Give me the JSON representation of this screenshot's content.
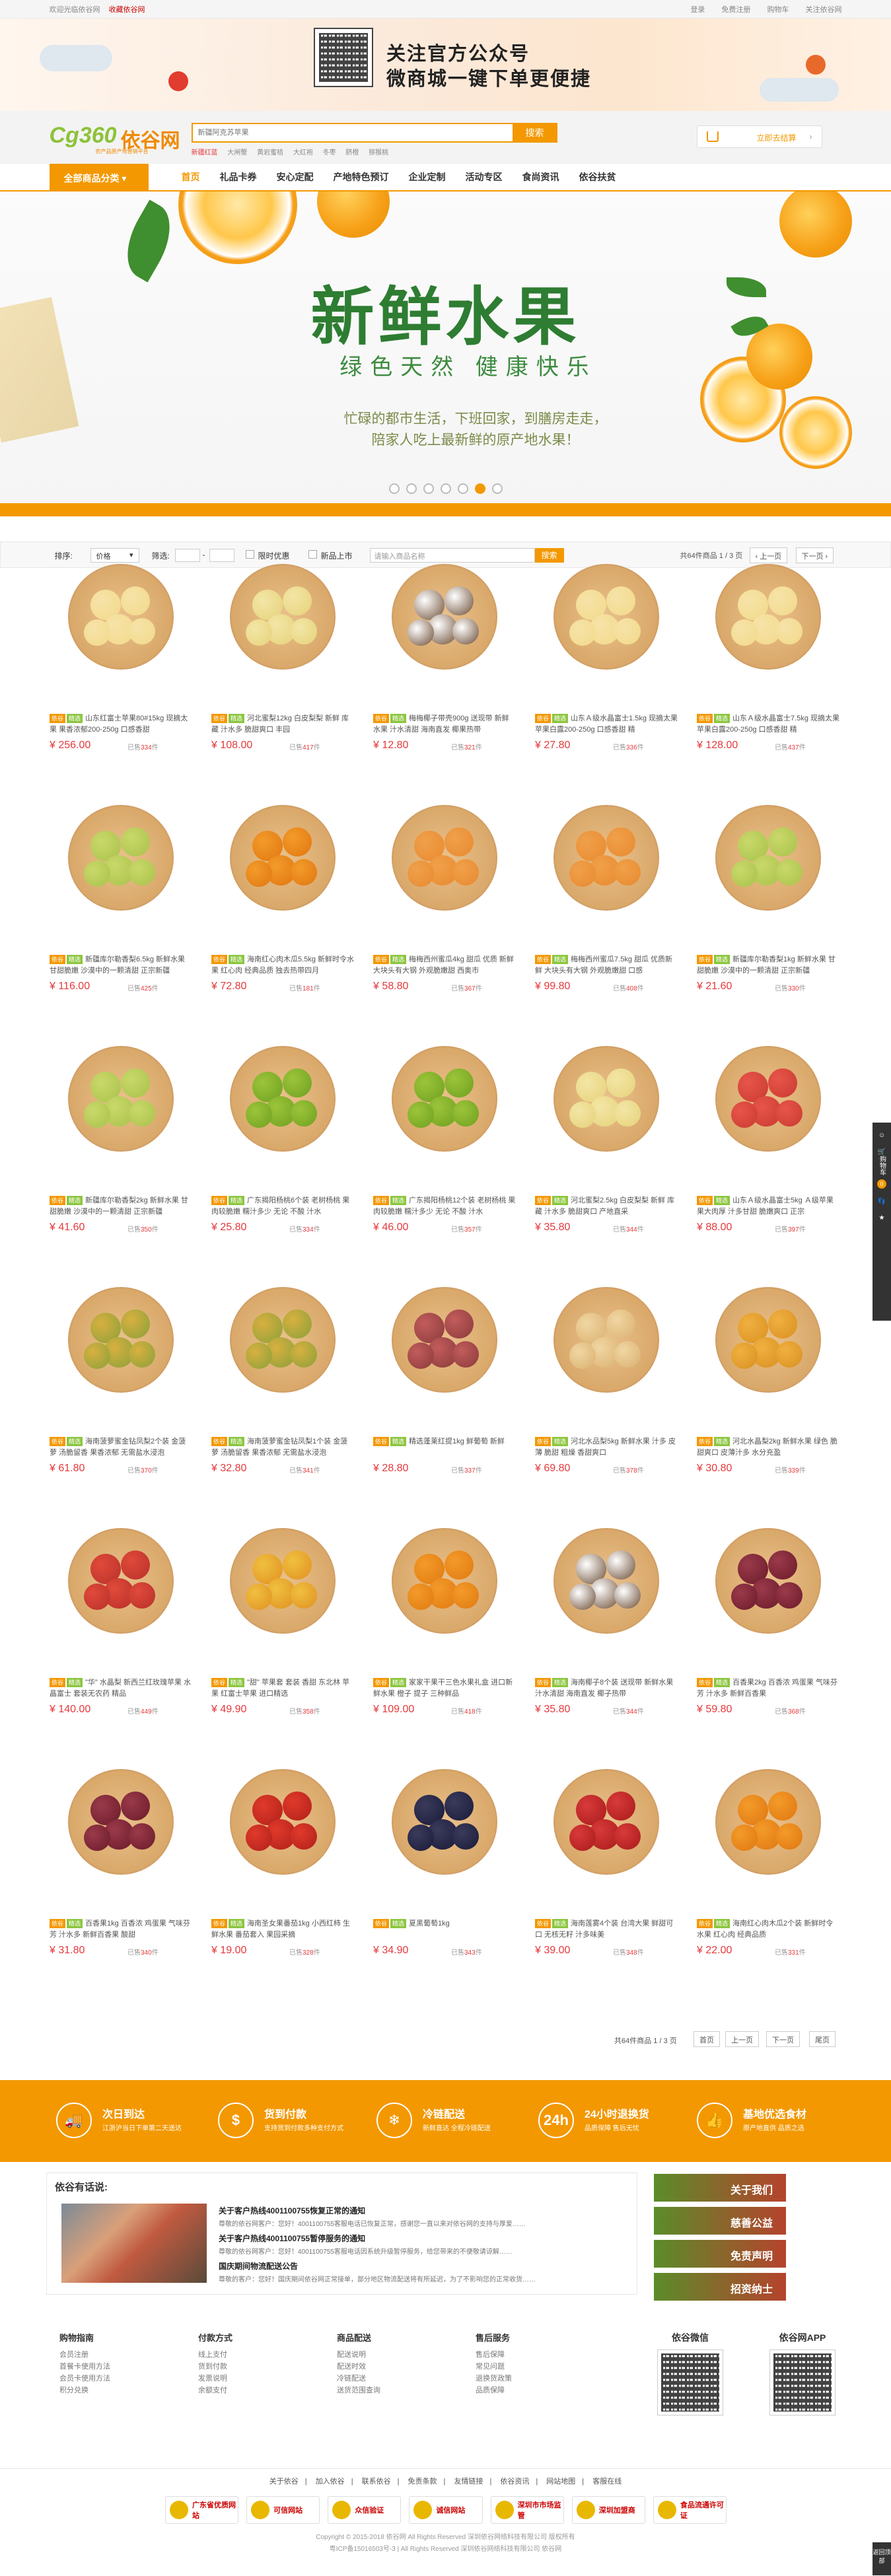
{
  "topbar": {
    "welcome": "欢迎光临依谷网",
    "favorite": "收藏依谷网",
    "login": "登录",
    "register": "免费注册",
    "cart": "购物车",
    "about": "关注依谷网"
  },
  "promo": {
    "line1": "关注官方公众号",
    "line2": "微商城一键下单更便捷"
  },
  "header": {
    "logo_mark": "Cg360",
    "logo_text": "依谷网",
    "logo_tagline": "农产品原产地营销平台",
    "search_placeholder": "新疆阿克苏苹果",
    "search_button": "搜索",
    "hot_words": [
      "新疆红蓝",
      "大闸蟹",
      "黄岩蜜桔",
      "大红袍",
      "冬枣",
      "脐橙",
      "猕猴桃"
    ],
    "cart_label": "立即去结算"
  },
  "nav": {
    "all_categories": "全部商品分类",
    "links": [
      "首页",
      "礼品卡券",
      "安心定配",
      "产地特色预订",
      "企业定制",
      "活动专区",
      "食尚资讯",
      "依谷扶贫"
    ]
  },
  "hero": {
    "title": "新鲜水果",
    "subtitle": "绿色天然 健康快乐",
    "desc1": "忙碌的都市生活，下班回家，到膳房走走，",
    "desc2": "陪家人吃上最新鲜的原产地水果！"
  },
  "filter": {
    "sort_label": "排序:",
    "sort_value": "价格",
    "range_label": "筛选:",
    "price_sep": "-",
    "check1": "限时优惠",
    "check2": "新品上市",
    "keyword_placeholder": "请输入商品名称",
    "search": "搜索",
    "page_info": "共64件商品 1 / 3 页",
    "prev": "上一页",
    "next": "下一页"
  },
  "products": [
    {
      "name": "山东红富士苹果80#15kg 现摘太果 果香浓郁200-250g 口感香甜",
      "price": "¥ 256.00",
      "sold": "334"
    },
    {
      "name": "河北蜜梨12kg 白皮梨梨 新鲜 库藏 汁水多 脆甜爽口 丰园",
      "price": "¥ 108.00",
      "sold": "417"
    },
    {
      "name": "梅梅椰子带壳900g 送现带 新鲜水果 汁水清甜 海南直发 椰果热带",
      "price": "¥ 12.80",
      "sold": "321"
    },
    {
      "name": "山东Ａ级水晶富士1.5kg 现摘太果 苹果白露200-250g 口感香甜 精",
      "price": "¥ 27.80",
      "sold": "336"
    },
    {
      "name": "山东Ａ级水晶富士7.5kg 现摘太果 苹果白露200-250g 口感香甜 精",
      "price": "¥ 128.00",
      "sold": "437"
    },
    {
      "name": "新疆库尔勒香梨6.5kg 新鲜水果 甘甜脆嫩 沙漠中的一颗清甜 正宗新疆",
      "price": "¥ 116.00",
      "sold": "425"
    },
    {
      "name": "海南红心肉木瓜5.5kg 新鲜时令水果 红心肉 经典品质 独去热带四月",
      "price": "¥ 72.80",
      "sold": "181"
    },
    {
      "name": "梅梅西州蜜瓜4kg 甜瓜 优质 新鲜 大块头有大钢 外观脆嫩甜 西奥市",
      "price": "¥ 58.80",
      "sold": "367"
    },
    {
      "name": "梅梅西州蜜瓜7.5kg 甜瓜 优质新鲜 大块头有大钢 外观脆嫩甜 口感",
      "price": "¥ 99.80",
      "sold": "408"
    },
    {
      "name": "新疆库尔勒香梨1kg 新鲜水果 甘甜脆嫩 沙漠中的一颗清甜 正宗新疆",
      "price": "¥ 21.60",
      "sold": "330"
    },
    {
      "name": "新疆库尔勒香梨2kg 新鲜水果 甘甜脆嫩 沙漠中的一颗清甜 正宗新疆",
      "price": "¥ 41.60",
      "sold": "350"
    },
    {
      "name": "广东揭阳杨桃6个装 老树杨桃 果肉较脆嫩 糯汁多少 无论 不酸 汁水",
      "price": "¥ 25.80",
      "sold": "334"
    },
    {
      "name": "广东揭阳杨桃12个装 老树杨桃 果肉较脆嫩 糯汁多少 无论 不酸 汁水",
      "price": "¥ 46.00",
      "sold": "357"
    },
    {
      "name": "河北蜜梨2.5kg 白皮梨梨 新鲜 库藏 汁水多 脆甜爽口 产地直采",
      "price": "¥ 35.80",
      "sold": "344"
    },
    {
      "name": "山东Ａ级水晶富士5kg Ａ级苹果 果大肉厚 汁多甘甜 脆嫩爽口 正宗",
      "price": "¥ 88.00",
      "sold": "397"
    },
    {
      "name": "海南菠萝蜜金钻凤梨2个装 金菠萝 汤脆留香 果香浓郁 无需盐水浸泡",
      "price": "¥ 61.80",
      "sold": "370"
    },
    {
      "name": "海南菠萝蜜金钻凤梨1个装 金菠萝 汤脆留香 果香浓郁 无需盐水浸泡",
      "price": "¥ 32.80",
      "sold": "341"
    },
    {
      "name": "精选蓬莱红提1kg 鲜葡萄 新鲜",
      "price": "¥ 28.80",
      "sold": "337"
    },
    {
      "name": "河北水品梨5kg 新鲜水果 汁多 皮薄 脆甜 粗燥 香甜爽口",
      "price": "¥ 69.80",
      "sold": "378"
    },
    {
      "name": "河北水晶梨2kg 新鲜水果 绿色 脆甜爽口 皮薄汁多 水分充盈",
      "price": "¥ 30.80",
      "sold": "339"
    },
    {
      "name": "\"华\" 水晶梨 新西兰红玫瑰苹果 水晶富士 套装无农药 精品",
      "price": "¥ 140.00",
      "sold": "449"
    },
    {
      "name": "\"甜\" 苹果套 套装 香甜 东北林 苹果 红富士苹果 进口精选",
      "price": "¥ 49.90",
      "sold": "358"
    },
    {
      "name": "家家干果干三色水果礼盒 进口新鲜水果 橙子 提子 三种鲜品",
      "price": "¥ 109.00",
      "sold": "418"
    },
    {
      "name": "海南椰子8个装 送现带 新鲜水果 汁水清甜 海南直发 椰子热带",
      "price": "¥ 35.80",
      "sold": "344"
    },
    {
      "name": "百香果2kg 百香浓 鸡蛋果 气味芬芳 汁水多 新鲜百香果",
      "price": "¥ 59.80",
      "sold": "368"
    },
    {
      "name": "百香果1kg 百香浓 鸡蛋果 气味芬芳 汁水多 新鲜百香果 酸甜",
      "price": "¥ 31.80",
      "sold": "340"
    },
    {
      "name": "海南圣女果番茄1kg 小西红柿 生鲜水果 番茄套入 果园采摘",
      "price": "¥ 19.00",
      "sold": "328"
    },
    {
      "name": "夏黑葡萄1kg",
      "price": "¥ 34.90",
      "sold": "343"
    },
    {
      "name": "海南莲雾4个装 台湾大果 鲜甜可口 无核无籽 汁多味美",
      "price": "¥ 39.00",
      "sold": "348"
    },
    {
      "name": "海南红心肉木瓜2个装 新鲜时令水果 红心肉 经典品质",
      "price": "¥ 22.00",
      "sold": "331"
    }
  ],
  "product_labels": {
    "badge1": "依谷",
    "badge2": "精选",
    "sold_prefix": "已售",
    "sold_suffix": "件"
  },
  "bottom_page": {
    "info": "共64件商品 1 / 3 页",
    "first": "首页",
    "prev": "上一页",
    "next": "下一页",
    "last": "尾页"
  },
  "services": [
    {
      "icon": "truck-icon",
      "title": "次日到达",
      "desc": "江浙沪当日下单第二天送达"
    },
    {
      "icon": "cash-icon",
      "title": "货到付款",
      "desc": "支持货到付款多种支付方式"
    },
    {
      "icon": "cold-chain-icon",
      "title": "冷链配送",
      "desc": "新鲜直达 全程冷链配送"
    },
    {
      "icon": "clock-24h-icon",
      "title": "24小时退换货",
      "desc": "品质保障 售后无忧"
    },
    {
      "icon": "thumb-icon",
      "title": "基地优选食材",
      "desc": "原产地直供 品质之选"
    }
  ],
  "news": {
    "heading": "依谷有话说:",
    "items": [
      {
        "title": "关于客户热线4001100755恢复正常的通知",
        "desc": "尊敬的依谷网客户：您好！4001100755客服电话已恢复正常，感谢您一直以来对依谷网的支持与厚爱……"
      },
      {
        "title": "关于客户热线4001100755暂停服务的通知",
        "desc": "尊敬的依谷网客户：您好！4001100755客服电话因系统升级暂停服务，给您带来的不便敬请谅解……"
      },
      {
        "title": "国庆期间物流配送公告",
        "desc": "尊敬的客户：您好！国庆期间依谷网正常接单，部分地区物流配送将有所延迟，为了不影响您的正常收货……"
      }
    ],
    "side": [
      "关于我们",
      "慈善公益",
      "免责声明",
      "招资纳士"
    ]
  },
  "footer": {
    "cols": [
      {
        "title": "购物指南",
        "items": [
          "会员注册",
          "首餐卡使用方法",
          "会员卡使用方法",
          "积分兑换"
        ]
      },
      {
        "title": "付款方式",
        "items": [
          "线上支付",
          "货到付款",
          "发票说明",
          "余额支付"
        ]
      },
      {
        "title": "商品配送",
        "items": [
          "配送说明",
          "配送时效",
          "冷链配送",
          "送货范围查询"
        ]
      },
      {
        "title": "售后服务",
        "items": [
          "售后保障",
          "常见问题",
          "退换货政策",
          "品质保障"
        ]
      }
    ],
    "qr1": "依谷微信",
    "qr2": "依谷网APP",
    "links": [
      "关于依谷",
      "加入依谷",
      "联系依谷",
      "免责条款",
      "友情链接",
      "依谷资讯",
      "网站地图",
      "客服在线"
    ],
    "badges": [
      "广东省优质网站",
      "可信网站",
      "众信验证",
      "诚信网站",
      "深圳市市场监管",
      "深圳加盟商",
      "食品流通许可证"
    ],
    "copy1": "Copyright © 2015-2018 依谷网 All Rights Reserved 深圳依谷网络科技有限公司 版权所有",
    "copy2": "粤ICP备15016503号-3 | All Rights Reserved 深圳依谷网络科技有限公司 依谷网"
  },
  "sidebar": {
    "cart": "购物车",
    "count": "0",
    "top": "返回顶部"
  }
}
